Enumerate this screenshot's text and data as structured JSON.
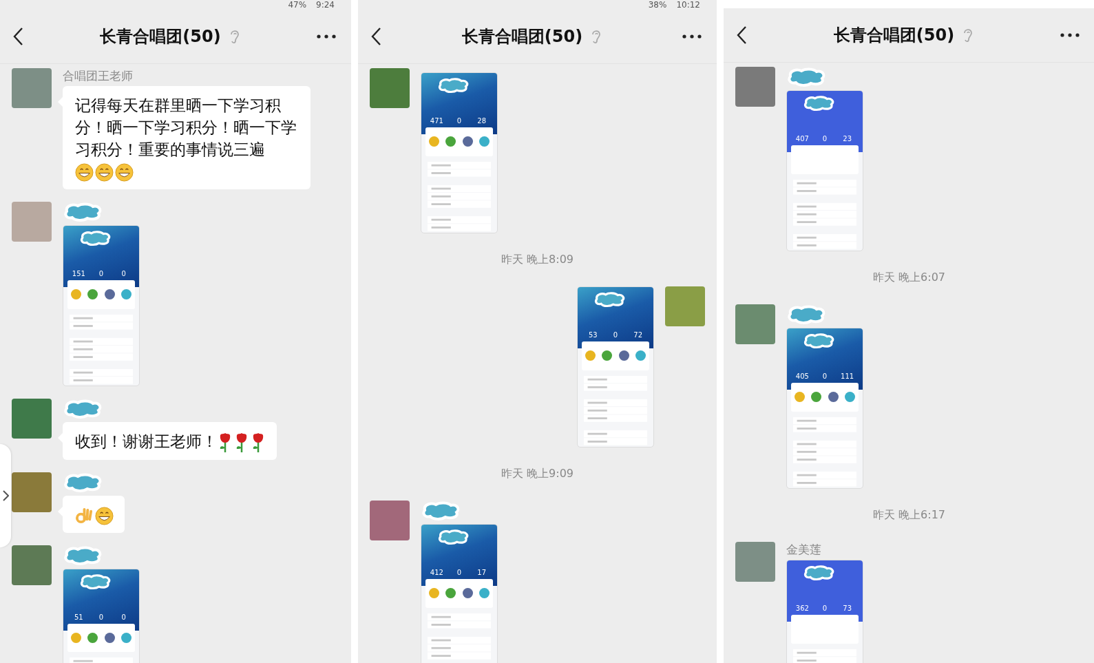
{
  "panels": [
    {
      "status_bar": {
        "battery": "47%",
        "time": "9:24"
      },
      "title": "长青合唱团(50)",
      "side_tab": true,
      "messages": [
        {
          "kind": "text",
          "sender": "合唱团王老师",
          "sender_hidden": false,
          "text": "记得每天在群里晒一下学习积分！晒一下学习积分！晒一下学习积分！重要的事情说三遍",
          "emoji": [
            {
              "kind": "grin"
            },
            {
              "kind": "grin"
            },
            {
              "kind": "grin"
            }
          ]
        },
        {
          "kind": "image",
          "sender_hidden": true,
          "blue_header": false,
          "stats": [
            "151",
            "0",
            "0"
          ]
        },
        {
          "kind": "text",
          "sender_hidden": true,
          "text": "收到！谢谢王老师！",
          "emoji": [
            {
              "kind": "rose"
            },
            {
              "kind": "rose"
            },
            {
              "kind": "rose"
            }
          ]
        },
        {
          "kind": "text",
          "sender_hidden": true,
          "emoji": [
            {
              "kind": "ok"
            },
            {
              "kind": "grin"
            }
          ]
        },
        {
          "kind": "image",
          "sender_hidden": true,
          "blue_header": false,
          "stats": [
            "51",
            "0",
            "0"
          ]
        }
      ]
    },
    {
      "status_bar": {
        "battery": "38%",
        "time": "10:12"
      },
      "title": "长青合唱团(50)",
      "messages": [
        {
          "kind": "image",
          "sender_hidden": false,
          "blue_header": false,
          "stats": [
            "471",
            "0",
            "28"
          ]
        },
        {
          "kind": "time",
          "text": "昨天 晚上8:09"
        },
        {
          "kind": "own_image",
          "blue_header": false,
          "stats": [
            "53",
            "0",
            "72"
          ]
        },
        {
          "kind": "time",
          "text": "昨天 晚上9:09"
        },
        {
          "kind": "image",
          "sender_hidden": true,
          "blue_header": false,
          "stats": [
            "412",
            "0",
            "17"
          ]
        }
      ]
    },
    {
      "title": "长青合唱团(50)",
      "messages": [
        {
          "kind": "image",
          "sender_hidden": true,
          "blue_header": true,
          "stats": [
            "407",
            "0",
            "23"
          ]
        },
        {
          "kind": "time",
          "text": "昨天 晚上6:07"
        },
        {
          "kind": "image",
          "sender_hidden": true,
          "blue_header": false,
          "stats": [
            "405",
            "0",
            "111"
          ]
        },
        {
          "kind": "time",
          "text": "昨天 晚上6:17"
        },
        {
          "kind": "image",
          "sender": "金美莲",
          "sender_hidden": false,
          "blue_header": true,
          "stats": [
            "362",
            "0",
            "73"
          ]
        }
      ]
    }
  ]
}
